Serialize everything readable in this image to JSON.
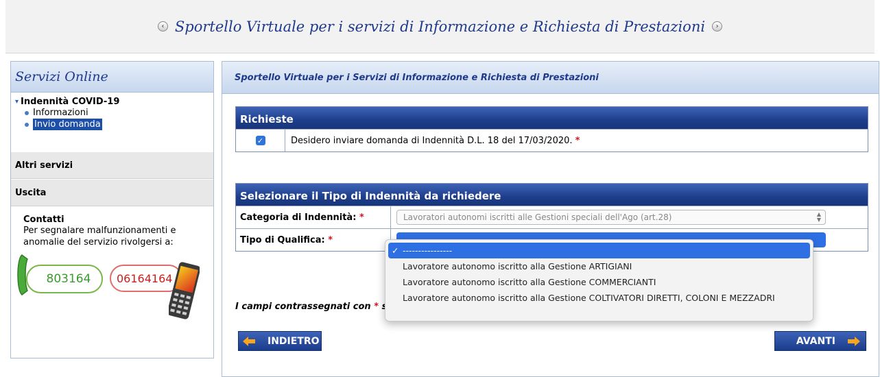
{
  "banner": {
    "title": "Sportello Virtuale per i servizi di Informazione e Richiesta di Prestazioni",
    "left_arrow": "‹",
    "right_arrow": "›"
  },
  "sidebar": {
    "title": "Servizi Online",
    "section": {
      "label": "Indennità COVID-19",
      "links": [
        {
          "label": "Informazioni",
          "active": false
        },
        {
          "label": "Invio domanda",
          "active": true
        }
      ]
    },
    "items": [
      {
        "label": "Altri servizi"
      },
      {
        "label": "Uscita"
      }
    ],
    "contacts": {
      "title": "Contatti",
      "text": "Per segnalare malfunzionamenti e anomalie del servizio rivolgersi a:",
      "phone_landline": "803164",
      "phone_mobile": "06164164"
    }
  },
  "main": {
    "header": "Sportello Virtuale per i Servizi di Informazione e Richiesta di Prestazioni",
    "requests": {
      "title": "Richieste",
      "checkbox_label": "Desidero inviare domanda di Indennità D.L. 18 del 17/03/2020.",
      "required_mark": "*",
      "checked": true
    },
    "selection": {
      "title": "Selezionare il Tipo di Indennità da richiedere",
      "category_label": "Categoria di Indennità:",
      "category_value": "Lavoratori autonomi iscritti alle Gestioni speciali dell'Ago (art.28)",
      "qualifica_label": "Tipo di Qualifica:",
      "required_mark": "*"
    },
    "dropdown": {
      "options": [
        {
          "label": "----------------",
          "selected": true
        },
        {
          "label": "Lavoratore autonomo iscritto alla Gestione ARTIGIANI",
          "selected": false
        },
        {
          "label": "Lavoratore autonomo iscritto alla Gestione COMMERCIANTI",
          "selected": false
        },
        {
          "label": "Lavoratore autonomo iscritto alla Gestione COLTIVATORI DIRETTI, COLONI E MEZZADRI",
          "selected": false
        }
      ],
      "check_glyph": "✓"
    },
    "footnote": {
      "text_before": "I campi contrassegnati con",
      "mark": "*",
      "text_after": "s"
    },
    "buttons": {
      "back": "INDIETRO",
      "next": "AVANTI"
    }
  },
  "colors": {
    "accent_blue": "#1f3a8c",
    "section_header": "#1d3e8c",
    "required": "#d4141f",
    "dropdown_selected": "#2f6fe4"
  }
}
